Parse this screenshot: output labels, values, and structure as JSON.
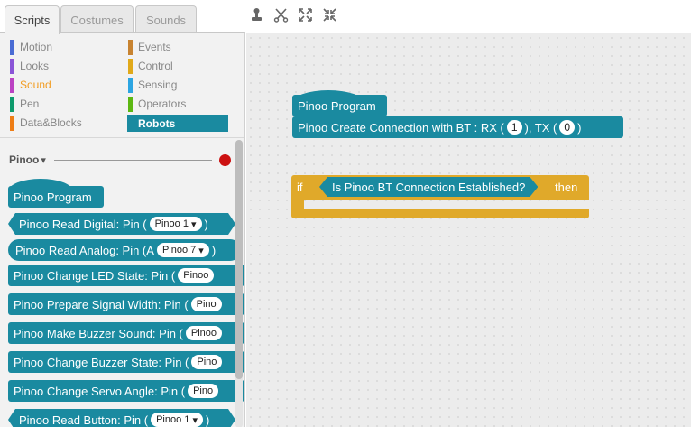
{
  "tabs": [
    {
      "label": "Scripts",
      "active": true
    },
    {
      "label": "Costumes",
      "active": false
    },
    {
      "label": "Sounds",
      "active": false
    }
  ],
  "toolbar": {
    "icons": [
      "stamp-icon",
      "cut-icon",
      "grow-icon",
      "shrink-icon"
    ]
  },
  "categories": {
    "left": [
      {
        "label": "Motion",
        "color": "#4a6cd4"
      },
      {
        "label": "Looks",
        "color": "#8a55d7"
      },
      {
        "label": "Sound",
        "color": "#bb42c3"
      },
      {
        "label": "Pen",
        "color": "#0e9a6c"
      },
      {
        "label": "Data&Blocks",
        "color": "#ee7d16"
      }
    ],
    "right": [
      {
        "label": "Events",
        "color": "#c88330"
      },
      {
        "label": "Control",
        "color": "#e1a91a"
      },
      {
        "label": "Sensing",
        "color": "#2ca5e2"
      },
      {
        "label": "Operators",
        "color": "#5cb712"
      },
      {
        "label": "Robots",
        "color": "#1a8aa0"
      }
    ],
    "selected": "Robots"
  },
  "extension": {
    "name": "Pinoo",
    "dropdown_glyph": "▾",
    "status_color": "#cc1111"
  },
  "palette_blocks": {
    "program": "Pinoo Program",
    "read_digital": {
      "text": "Pinoo Read Digital: Pin (",
      "pin": "Pinoo 1",
      "close": ")"
    },
    "read_analog": {
      "text": "Pinoo Read Analog: Pin (A",
      "pin": "Pinoo 7",
      "close": ")"
    },
    "change_led": {
      "text": "Pinoo Change LED State: Pin (",
      "pin": "Pinoo"
    },
    "prepare_signal": {
      "text": "Pinoo Prepare Signal Width: Pin (",
      "pin": "Pino"
    },
    "buzzer_sound": {
      "text": "Pinoo Make Buzzer Sound: Pin (",
      "pin": "Pinoo"
    },
    "buzzer_state": {
      "text": "Pinoo Change Buzzer State: Pin (",
      "pin": "Pino"
    },
    "servo_angle": {
      "text": "Pinoo Change Servo Angle: Pin (",
      "pin": "Pino"
    },
    "read_button": {
      "text": "Pinoo Read Button: Pin (",
      "pin": "Pinoo 1",
      "close": ")"
    }
  },
  "script": {
    "hat": "Pinoo Program",
    "create_conn": {
      "text": "Pinoo Create Connection with BT : RX (",
      "rx": "1",
      "mid": "), TX (",
      "tx": "0",
      "close": ")"
    },
    "if_label": "if",
    "condition": "Is Pinoo BT Connection Established?",
    "then_label": "then"
  }
}
